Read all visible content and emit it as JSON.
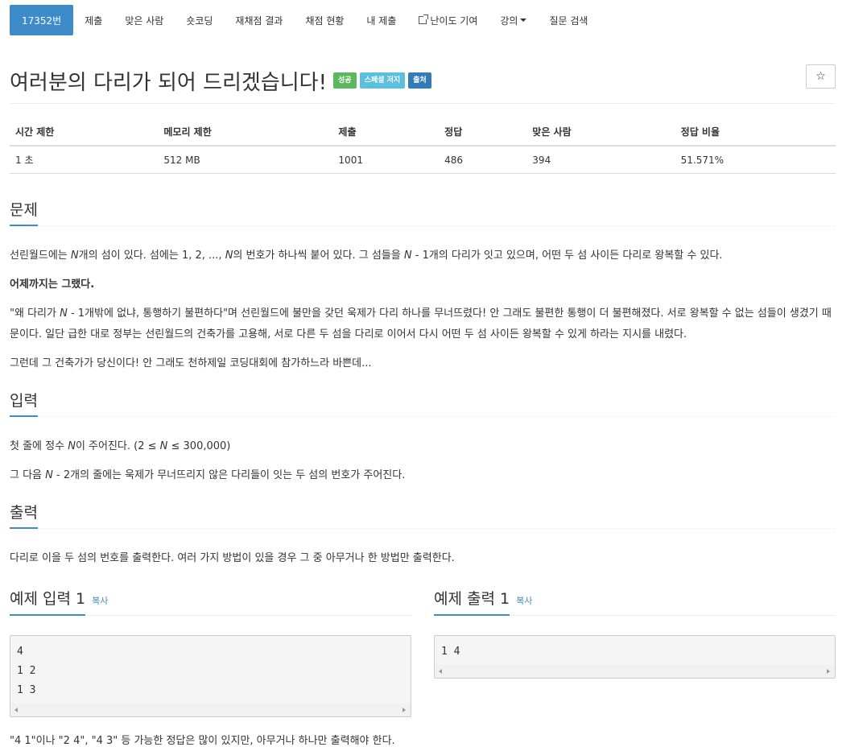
{
  "nav": {
    "items": [
      {
        "label": "17352번",
        "active": true
      },
      {
        "label": "제출"
      },
      {
        "label": "맞은 사람"
      },
      {
        "label": "숏코딩"
      },
      {
        "label": "재채점 결과"
      },
      {
        "label": "채점 현황"
      },
      {
        "label": "내 제출"
      },
      {
        "label": "난이도 기여",
        "icon": "external-link-icon"
      },
      {
        "label": "강의",
        "icon": "caret-down-icon"
      },
      {
        "label": "질문 검색"
      }
    ]
  },
  "problem": {
    "title": "여러분의 다리가 되어 드리겠습니다!",
    "badges": [
      "성공",
      "스페셜 저지",
      "출처"
    ],
    "star": "☆"
  },
  "info": {
    "headers": [
      "시간 제한",
      "메모리 제한",
      "제출",
      "정답",
      "맞은 사람",
      "정답 비율"
    ],
    "values": [
      "1 초",
      "512 MB",
      "1001",
      "486",
      "394",
      "51.571%"
    ]
  },
  "description": {
    "heading": "문제",
    "p1a": "선린월드에는 ",
    "p1n": "N",
    "p1b": "개의 섬이 있다. 섬에는 1, 2, ..., ",
    "p1n2": "N",
    "p1c": "의 번호가 하나씩 붙어 있다. 그 섬들을 ",
    "p1n3": "N",
    "p1d": " - 1개의 다리가 잇고 있으며, 어떤 두 섬 사이든 다리로 왕복할 수 있다.",
    "p2": "어제까지는 그랬다.",
    "p3a": "\"왜 다리가 ",
    "p3n": "N",
    "p3b": " - 1개밖에 없냐, 통행하기 불편하다\"며 선린월드에 불만을 갖던 욱제가 다리 하나를 무너뜨렸다! 안 그래도 불편한 통행이 더 불편해졌다. 서로 왕복할 수 없는 섬들이 생겼기 때문이다. 일단 급한 대로 정부는 선린월드의 건축가를 고용해, 서로 다른 두 섬을 다리로 이어서 다시 어떤 두 섬 사이든 왕복할 수 있게 하라는 지시를 내렸다.",
    "p4": "그런데 그 건축가가 당신이다! 안 그래도 천하제일 코딩대회에 참가하느라 바쁜데..."
  },
  "input": {
    "heading": "입력",
    "l1a": "첫 줄에 정수 ",
    "l1n": "N",
    "l1b": "이 주어진다. (2 ≤ ",
    "l1n2": "N",
    "l1c": " ≤ 300,000)",
    "l2a": "그 다음 ",
    "l2n": "N",
    "l2b": " - 2개의 줄에는 욱제가 무너뜨리지 않은 다리들이 잇는 두 섬의 번호가 주어진다."
  },
  "output": {
    "heading": "출력",
    "text": "다리로 이을 두 섬의 번호를 출력한다. 여러 가지 방법이 있을 경우 그 중 아무거나 한 방법만 출력한다."
  },
  "samples": {
    "input_title": "예제 입력 1",
    "output_title": "예제 출력 1",
    "copy": "복사",
    "input_lines": [
      "4",
      "1 2",
      "1 3"
    ],
    "output_lines": [
      "1 4"
    ],
    "note": "\"4 1\"이나 \"2 4\", \"4 3\" 등 가능한 정답은 많이 있지만, 아무거나 하나만 출력해야 한다."
  },
  "colors": {
    "accent": "#3d8cc9",
    "success": "#5cb85c",
    "info": "#5bc0de",
    "primary": "#337ab7"
  }
}
